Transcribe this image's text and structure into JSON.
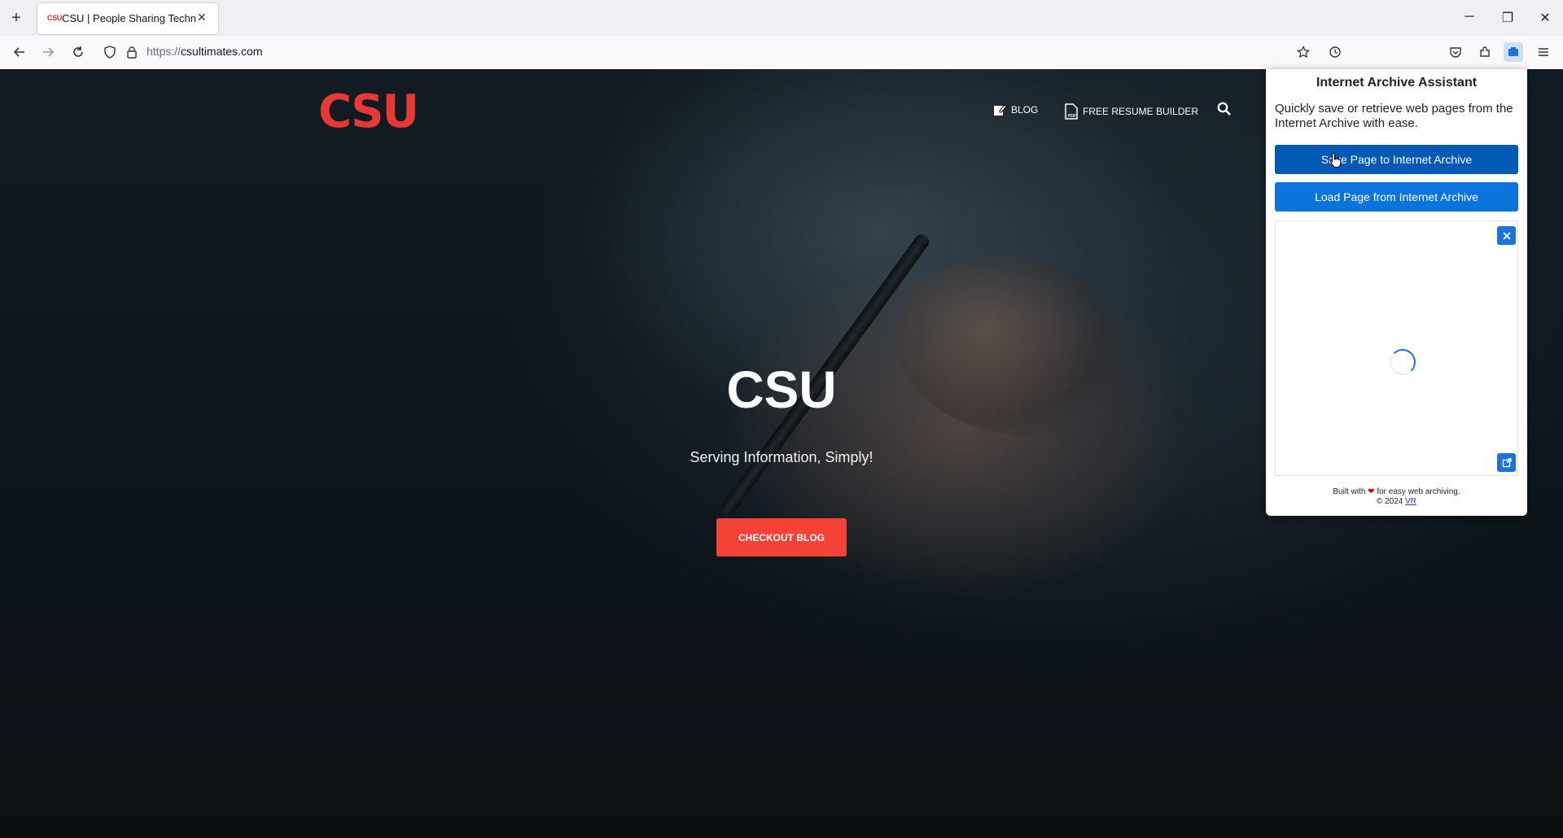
{
  "browser": {
    "tab_title": "CSU | People Sharing Technolo",
    "tab_favicon_text": "CSU",
    "url_protocol": "https://",
    "url_host": "csultimates.com"
  },
  "site": {
    "logo_text": "CSU",
    "nav": [
      {
        "label": "BLOG",
        "icon": "edit-icon"
      },
      {
        "label": "FREE RESUME BUILDER",
        "icon": "pdf-file-icon"
      }
    ],
    "hero_title": "CSU",
    "hero_subtitle": "Serving Information, Simply!",
    "cta_label": "CHECKOUT BLOG",
    "accent_color": "#f44336"
  },
  "extension_popup": {
    "title": "Internet Archive Assistant",
    "description": "Quickly save or retrieve web pages from the Internet Archive with ease.",
    "save_button": "Save Page to Internet Archive",
    "load_button": "Load Page from Internet Archive",
    "footer_built_prefix": "Built with",
    "footer_built_suffix": "for easy web archiving.",
    "footer_copyright": "© 2024",
    "footer_link": "VR",
    "colors": {
      "save_button": "#0059b3",
      "load_button": "#0a74da"
    }
  }
}
